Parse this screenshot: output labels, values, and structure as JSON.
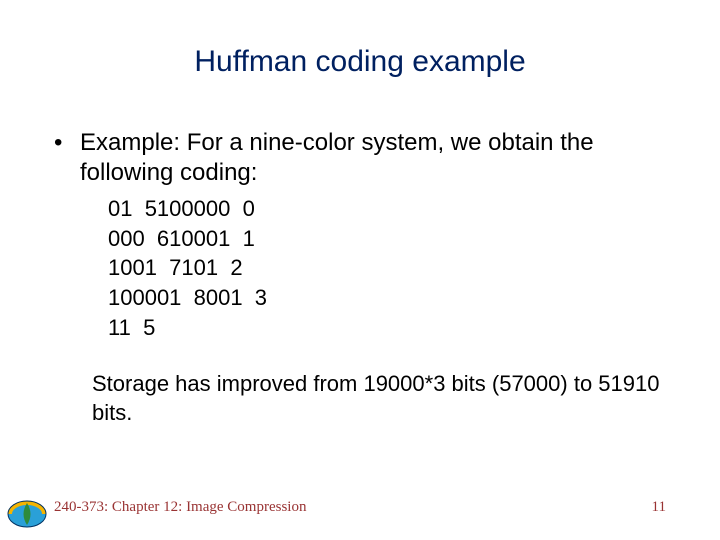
{
  "title": "Huffman coding example",
  "bullet_text": "Example:  For a nine-color system, we obtain the following coding:",
  "code_lines": [
    "01  5100000  0",
    "000  610001  1",
    "1001  7101  2",
    "100001  8001  3",
    "11  5"
  ],
  "summary": "Storage has improved from 19000*3 bits (57000)  to 51910 bits.",
  "footer_left": "240-373: Chapter 12: Image Compression",
  "footer_right": "11"
}
